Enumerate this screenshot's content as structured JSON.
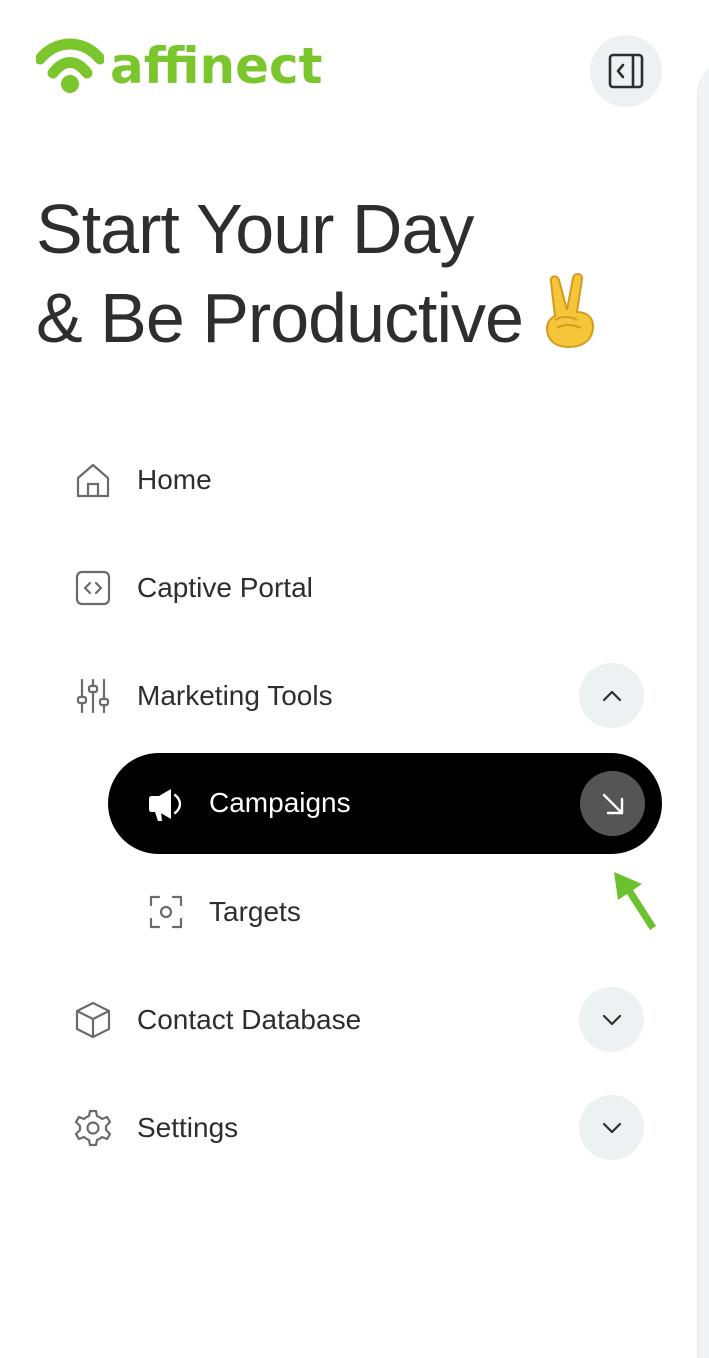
{
  "brand": {
    "name": "affinect",
    "color": "#7cc62d"
  },
  "header": {
    "collapse_icon": "sidebar-collapse-icon"
  },
  "greeting": {
    "line1": "Start Your Day",
    "line2": "& Be Productive",
    "emoji": "victory-hand-emoji"
  },
  "nav": {
    "home": {
      "label": "Home",
      "icon": "home-icon"
    },
    "captive_portal": {
      "label": "Captive Portal",
      "icon": "code-icon"
    },
    "marketing_tools": {
      "label": "Marketing Tools",
      "icon": "sliders-icon",
      "expanded": true,
      "children": {
        "campaigns": {
          "label": "Campaigns",
          "icon": "megaphone-icon",
          "active": true
        },
        "targets": {
          "label": "Targets",
          "icon": "target-focus-icon"
        }
      }
    },
    "contact_database": {
      "label": "Contact Database",
      "icon": "cube-icon",
      "expanded": false
    },
    "settings": {
      "label": "Settings",
      "icon": "gear-icon",
      "expanded": false
    }
  },
  "colors": {
    "active_bg": "#000000",
    "pill_bg": "#eef1f2",
    "pointer_arrow": "#6cc12f"
  }
}
